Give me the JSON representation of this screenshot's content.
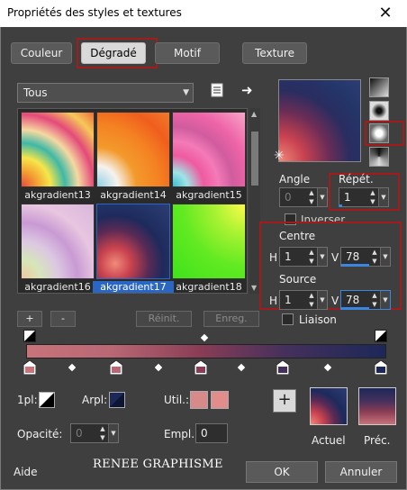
{
  "window": {
    "title": "Propriétés des styles et textures",
    "close_glyph": "✕"
  },
  "tabs": [
    {
      "label": "Couleur"
    },
    {
      "label": "Dégradé"
    },
    {
      "label": "Motif"
    },
    {
      "label": "Texture"
    }
  ],
  "active_tab": "Dégradé",
  "category_dropdown": {
    "value": "Tous"
  },
  "gradients": [
    {
      "name": "akgradient13"
    },
    {
      "name": "akgradient14"
    },
    {
      "name": "akgradient15"
    },
    {
      "name": "akgradient16"
    },
    {
      "name": "akgradient17",
      "selected": true
    },
    {
      "name": "akgradient18"
    }
  ],
  "angle": {
    "label": "Angle",
    "value": "0"
  },
  "repeat": {
    "label": "Répét.",
    "value": "1",
    "level_fraction": 0.05
  },
  "invert": {
    "label": "Inverser",
    "checked": false
  },
  "centre": {
    "label": "Centre",
    "h_label": "H",
    "h_value": "1",
    "v_label": "V",
    "v_value": "78",
    "v_level_fraction": 0.78
  },
  "source": {
    "label": "Source",
    "h_label": "H",
    "h_value": "1",
    "v_label": "V",
    "v_value": "78",
    "v_level_fraction": 0.78
  },
  "link": {
    "label": "Liaison",
    "checked": false
  },
  "buttons": {
    "add": "+",
    "remove": "-",
    "reset": "Réinit.",
    "save": "Enreg.",
    "ok": "OK",
    "cancel": "Annuler",
    "help": "Aide",
    "add_swatch": "+"
  },
  "gradient_bar": {
    "colors": [
      "#c9737a",
      "#b86774",
      "#8a3d55",
      "#45305c",
      "#1c2858"
    ]
  },
  "foreground_label": "1pl:",
  "background_label": "Arpl:",
  "user_label": "Util.:",
  "opacity": {
    "label": "Opacité:",
    "value": "0"
  },
  "location": {
    "label": "Empl.:",
    "value": "0"
  },
  "preview_current_label": "Actuel",
  "preview_previous_label": "Préc.",
  "brand": "RENEE GRAPHISME",
  "colors": {
    "accent_red": "#a31c1c",
    "selection_blue": "#2a66c4",
    "dialog_bg": "#3f3f3f"
  }
}
